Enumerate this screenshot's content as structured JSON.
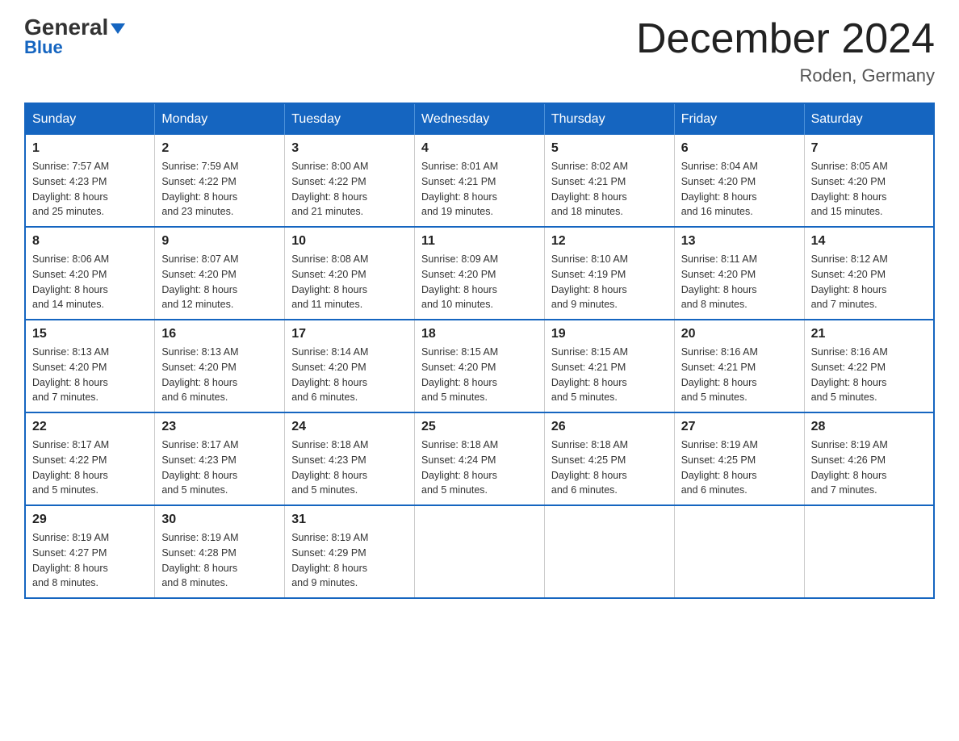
{
  "logo": {
    "text1": "General",
    "text2": "Blue"
  },
  "title": {
    "month_year": "December 2024",
    "location": "Roden, Germany"
  },
  "days_of_week": [
    "Sunday",
    "Monday",
    "Tuesday",
    "Wednesday",
    "Thursday",
    "Friday",
    "Saturday"
  ],
  "weeks": [
    [
      {
        "day": 1,
        "sunrise": "7:57 AM",
        "sunset": "4:23 PM",
        "daylight": "8 hours and 25 minutes."
      },
      {
        "day": 2,
        "sunrise": "7:59 AM",
        "sunset": "4:22 PM",
        "daylight": "8 hours and 23 minutes."
      },
      {
        "day": 3,
        "sunrise": "8:00 AM",
        "sunset": "4:22 PM",
        "daylight": "8 hours and 21 minutes."
      },
      {
        "day": 4,
        "sunrise": "8:01 AM",
        "sunset": "4:21 PM",
        "daylight": "8 hours and 19 minutes."
      },
      {
        "day": 5,
        "sunrise": "8:02 AM",
        "sunset": "4:21 PM",
        "daylight": "8 hours and 18 minutes."
      },
      {
        "day": 6,
        "sunrise": "8:04 AM",
        "sunset": "4:20 PM",
        "daylight": "8 hours and 16 minutes."
      },
      {
        "day": 7,
        "sunrise": "8:05 AM",
        "sunset": "4:20 PM",
        "daylight": "8 hours and 15 minutes."
      }
    ],
    [
      {
        "day": 8,
        "sunrise": "8:06 AM",
        "sunset": "4:20 PM",
        "daylight": "8 hours and 14 minutes."
      },
      {
        "day": 9,
        "sunrise": "8:07 AM",
        "sunset": "4:20 PM",
        "daylight": "8 hours and 12 minutes."
      },
      {
        "day": 10,
        "sunrise": "8:08 AM",
        "sunset": "4:20 PM",
        "daylight": "8 hours and 11 minutes."
      },
      {
        "day": 11,
        "sunrise": "8:09 AM",
        "sunset": "4:20 PM",
        "daylight": "8 hours and 10 minutes."
      },
      {
        "day": 12,
        "sunrise": "8:10 AM",
        "sunset": "4:19 PM",
        "daylight": "8 hours and 9 minutes."
      },
      {
        "day": 13,
        "sunrise": "8:11 AM",
        "sunset": "4:20 PM",
        "daylight": "8 hours and 8 minutes."
      },
      {
        "day": 14,
        "sunrise": "8:12 AM",
        "sunset": "4:20 PM",
        "daylight": "8 hours and 7 minutes."
      }
    ],
    [
      {
        "day": 15,
        "sunrise": "8:13 AM",
        "sunset": "4:20 PM",
        "daylight": "8 hours and 7 minutes."
      },
      {
        "day": 16,
        "sunrise": "8:13 AM",
        "sunset": "4:20 PM",
        "daylight": "8 hours and 6 minutes."
      },
      {
        "day": 17,
        "sunrise": "8:14 AM",
        "sunset": "4:20 PM",
        "daylight": "8 hours and 6 minutes."
      },
      {
        "day": 18,
        "sunrise": "8:15 AM",
        "sunset": "4:20 PM",
        "daylight": "8 hours and 5 minutes."
      },
      {
        "day": 19,
        "sunrise": "8:15 AM",
        "sunset": "4:21 PM",
        "daylight": "8 hours and 5 minutes."
      },
      {
        "day": 20,
        "sunrise": "8:16 AM",
        "sunset": "4:21 PM",
        "daylight": "8 hours and 5 minutes."
      },
      {
        "day": 21,
        "sunrise": "8:16 AM",
        "sunset": "4:22 PM",
        "daylight": "8 hours and 5 minutes."
      }
    ],
    [
      {
        "day": 22,
        "sunrise": "8:17 AM",
        "sunset": "4:22 PM",
        "daylight": "8 hours and 5 minutes."
      },
      {
        "day": 23,
        "sunrise": "8:17 AM",
        "sunset": "4:23 PM",
        "daylight": "8 hours and 5 minutes."
      },
      {
        "day": 24,
        "sunrise": "8:18 AM",
        "sunset": "4:23 PM",
        "daylight": "8 hours and 5 minutes."
      },
      {
        "day": 25,
        "sunrise": "8:18 AM",
        "sunset": "4:24 PM",
        "daylight": "8 hours and 5 minutes."
      },
      {
        "day": 26,
        "sunrise": "8:18 AM",
        "sunset": "4:25 PM",
        "daylight": "8 hours and 6 minutes."
      },
      {
        "day": 27,
        "sunrise": "8:19 AM",
        "sunset": "4:25 PM",
        "daylight": "8 hours and 6 minutes."
      },
      {
        "day": 28,
        "sunrise": "8:19 AM",
        "sunset": "4:26 PM",
        "daylight": "8 hours and 7 minutes."
      }
    ],
    [
      {
        "day": 29,
        "sunrise": "8:19 AM",
        "sunset": "4:27 PM",
        "daylight": "8 hours and 8 minutes."
      },
      {
        "day": 30,
        "sunrise": "8:19 AM",
        "sunset": "4:28 PM",
        "daylight": "8 hours and 8 minutes."
      },
      {
        "day": 31,
        "sunrise": "8:19 AM",
        "sunset": "4:29 PM",
        "daylight": "8 hours and 9 minutes."
      },
      null,
      null,
      null,
      null
    ]
  ],
  "labels": {
    "sunrise": "Sunrise:",
    "sunset": "Sunset:",
    "daylight": "Daylight:"
  }
}
